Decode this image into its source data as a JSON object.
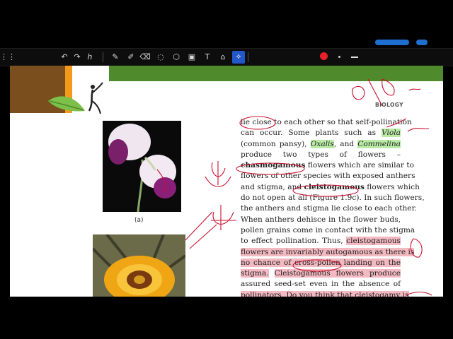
{
  "toolbar": {
    "tools": [
      {
        "name": "undo-icon",
        "glyph": "↶"
      },
      {
        "name": "redo-icon",
        "glyph": "↷"
      },
      {
        "name": "handwriting-icon",
        "glyph": "ℎ"
      },
      {
        "name": "pen-icon",
        "glyph": "✎"
      },
      {
        "name": "marker-icon",
        "glyph": "✐"
      },
      {
        "name": "eraser-icon",
        "glyph": "⌫"
      },
      {
        "name": "lasso-icon",
        "glyph": "◌"
      },
      {
        "name": "shapes-icon",
        "glyph": "⬡"
      },
      {
        "name": "image-icon",
        "glyph": "▣"
      },
      {
        "name": "text-icon",
        "glyph": "T"
      },
      {
        "name": "sticker-icon",
        "glyph": "⌂"
      },
      {
        "name": "laser-icon",
        "glyph": "✧"
      }
    ],
    "active_tool": "laser-icon",
    "record_color": "#e8202a"
  },
  "page": {
    "header_label": "BIOLOGY",
    "figure_caption_a": "(a)",
    "text_lines": [
      [
        {
          "t": "lie close to each other so that self-pollination"
        }
      ],
      [
        {
          "t": "can occur. Some plants such as "
        },
        {
          "t": "Viola",
          "i": true,
          "hl": "g"
        }
      ],
      [
        {
          "t": "(common pansy), "
        },
        {
          "t": "Oxalis",
          "i": true,
          "hl": "g"
        },
        {
          "t": ", and "
        },
        {
          "t": "Commelina",
          "i": true,
          "hl": "g"
        }
      ],
      [
        {
          "t": "produce two types of flowers –"
        }
      ],
      [
        {
          "t": "chasmogamous",
          "b": true
        },
        {
          "t": " flowers which are similar to"
        }
      ],
      [
        {
          "t": "flowers of other species with exposed anthers"
        }
      ],
      [
        {
          "t": "and stigma, and "
        },
        {
          "t": "cleistogamous",
          "b": true
        },
        {
          "t": " flowers which"
        }
      ],
      [
        {
          "t": "do not open at all (Figure 1.9c). In such flowers,"
        }
      ],
      [
        {
          "t": "the anthers and stigma lie close to each other."
        }
      ],
      [
        {
          "t": "When anthers dehisce in the flower buds,"
        }
      ],
      [
        {
          "t": "pollen grains come in contact with the stigma"
        }
      ],
      [
        {
          "t": "to effect pollination. Thus, "
        },
        {
          "t": "cleistogamous",
          "hl": "p"
        }
      ],
      [
        {
          "t": "flowers are invariably autogamous as there is",
          "hl": "p"
        }
      ],
      [
        {
          "t": "no chance of cross-pollen landing on the",
          "hl": "p"
        }
      ],
      [
        {
          "t": "stigma.",
          "hl": "p"
        },
        {
          "t": " "
        },
        {
          "t": "Cleistogamous flowers produce",
          "hl": "p"
        }
      ],
      [
        {
          "t": "assured seed-set even in the absence of"
        }
      ],
      [
        {
          "t": "pollinators. Do you think that cleistogamy is",
          "hl": "p"
        }
      ]
    ]
  },
  "colors": {
    "green_band": "#4f8a2c",
    "brown_band": "#7a4e1d",
    "orange_band": "#f19a1c",
    "green_highlight": "#b9eba6",
    "pink_highlight": "#f3b9c1",
    "ink_red": "#c8102e"
  }
}
